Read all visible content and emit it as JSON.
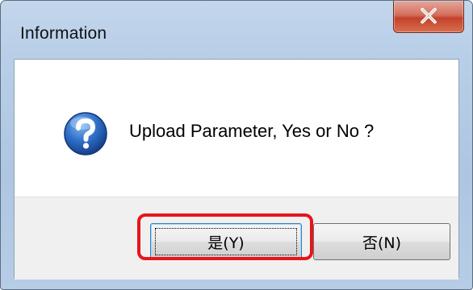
{
  "dialog": {
    "title": "Information",
    "message": "Upload Parameter, Yes or No ?",
    "icon": "question-icon"
  },
  "buttons": {
    "yes_label": "是(Y)",
    "no_label": "否(N)"
  },
  "colors": {
    "highlight": "#e8141c",
    "close_button": "#c4412c",
    "icon_blue": "#1f5fb8"
  }
}
